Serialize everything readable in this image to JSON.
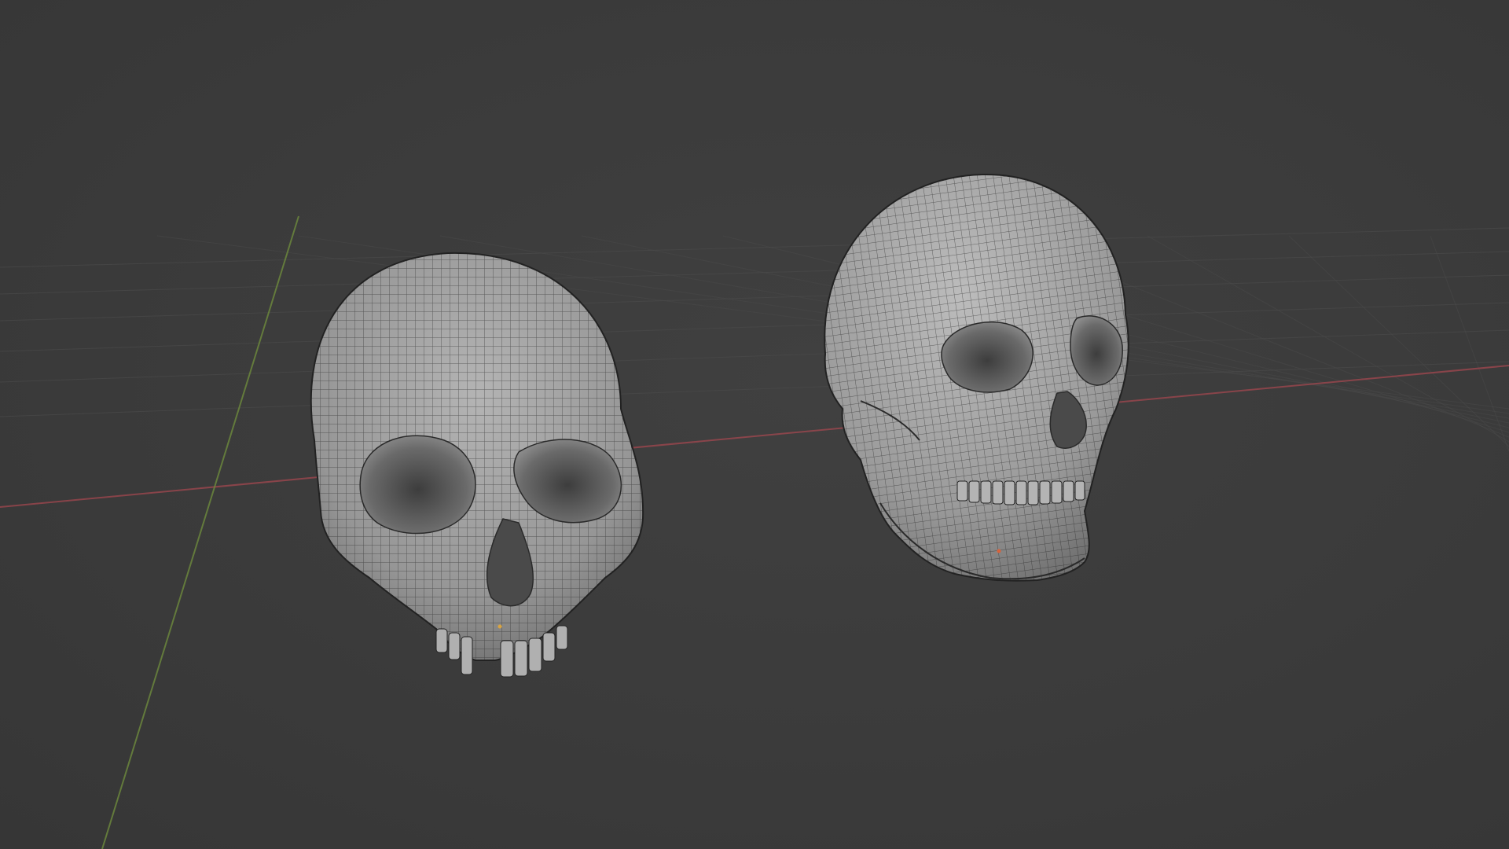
{
  "app": "3D Viewport",
  "viewport": {
    "background_color": "#3c3c3c",
    "grid_line_color": "#4a4a4a",
    "x_axis_color": "#a3474f",
    "y_axis_color": "#6e8b3d"
  },
  "objects": [
    {
      "name": "skull-upper-cranium",
      "view": "front",
      "has_jaw": false,
      "wireframe_overlay": true,
      "mesh_color": "#9e9e9e",
      "wire_color": "#1e1e1e"
    },
    {
      "name": "skull-full-with-jaw",
      "view": "three-quarter",
      "has_jaw": true,
      "wireframe_overlay": true,
      "mesh_color": "#a5a5a5",
      "wire_color": "#1e1e1e"
    }
  ],
  "selection_markers": [
    {
      "color": "#d9a441"
    },
    {
      "color": "#d9623b"
    }
  ]
}
